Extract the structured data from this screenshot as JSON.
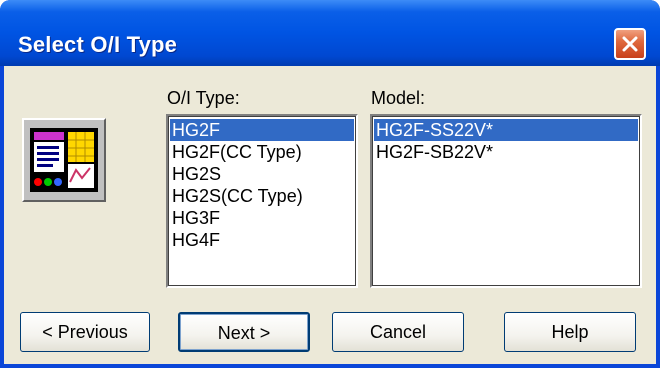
{
  "window": {
    "title": "Select O/I Type"
  },
  "oi_type": {
    "label": "O/I Type:",
    "items": [
      "HG2F",
      "HG2F(CC Type)",
      "HG2S",
      "HG2S(CC Type)",
      "HG3F",
      "HG4F"
    ],
    "selected": "HG2F"
  },
  "model": {
    "label": "Model:",
    "items": [
      "HG2F-SS22V*",
      "HG2F-SB22V*"
    ],
    "selected": "HG2F-SS22V*"
  },
  "buttons": {
    "previous": "< Previous",
    "next": "Next >",
    "cancel": "Cancel",
    "help": "Help"
  },
  "colors": {
    "titlebar": "#0054e3",
    "selection": "#316ac5",
    "dialog_bg": "#ece9d8",
    "close_button": "#e06a3e"
  },
  "icons": {
    "close": "close-icon",
    "app": "operator-interface-icon"
  }
}
